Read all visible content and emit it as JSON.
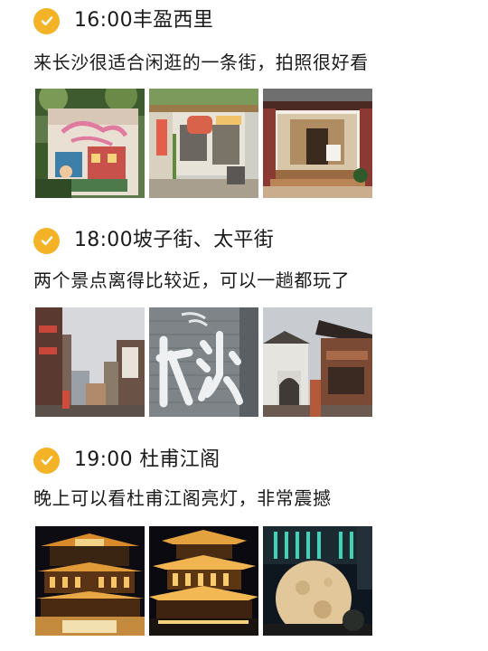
{
  "sections": [
    {
      "time": "16:00",
      "place": "丰盈西里",
      "description": "来长沙很适合闲逛的一条街，拍照很好看",
      "photos": [
        "mural-changsha-photo",
        "shop-storefront-photo",
        "old-gate-entrance-photo"
      ]
    },
    {
      "time": "18:00",
      "place": "坡子街、太平街",
      "description": "两个景点离得比较近，可以一趟都玩了",
      "photos": [
        "pozi-street-photo",
        "changsha-wall-photo",
        "taiping-street-gate-photo"
      ]
    },
    {
      "time": "19:00",
      "place": "杜甫江阁",
      "description": "晚上可以看杜甫江阁亮灯，非常震撼",
      "photos": [
        "dufu-pavilion-night-photo",
        "pavilion-lit-close-photo",
        "moon-lamp-night-photo"
      ]
    }
  ],
  "colors": {
    "accent": "#f4b326",
    "text": "#1b1b1b"
  }
}
